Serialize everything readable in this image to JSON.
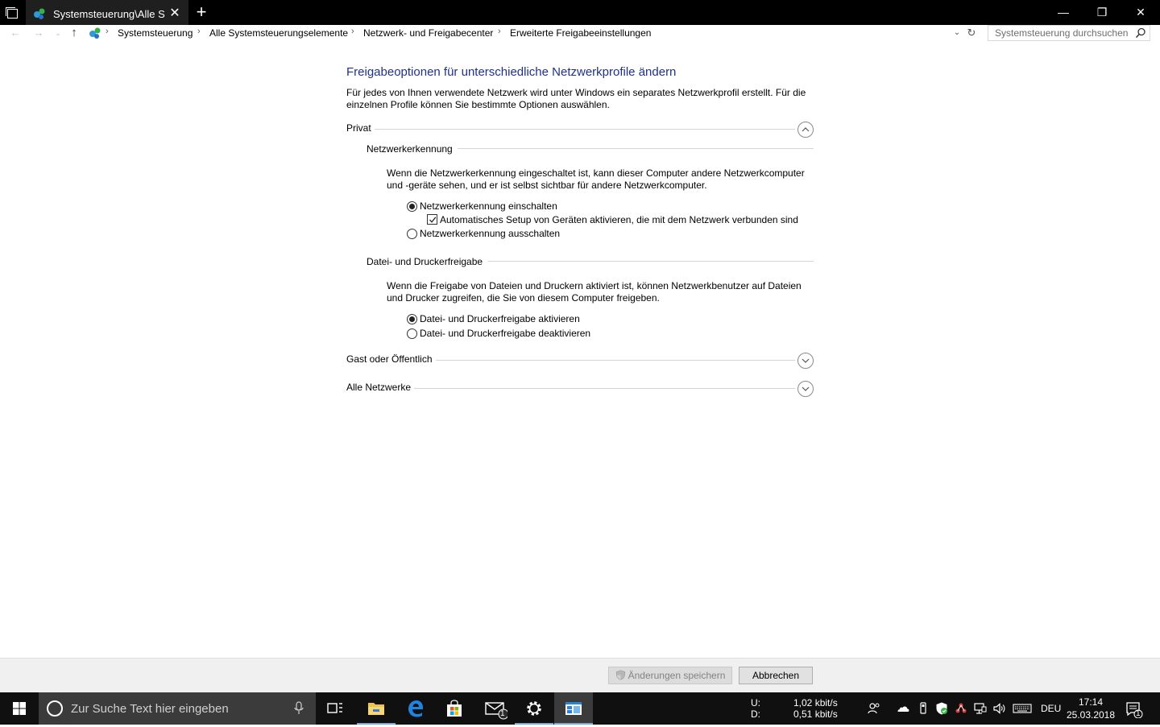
{
  "window": {
    "tab_title": "Systemsteuerung\\Alle S",
    "tab_close": "✕",
    "tab_add": "+",
    "minimize": "—",
    "maximize": "❐",
    "close": "✕"
  },
  "address": {
    "crumbs": [
      "Systemsteuerung",
      "Alle Systemsteuerungselemente",
      "Netzwerk- und Freigabecenter",
      "Erweiterte Freigabeeinstellungen"
    ],
    "separator": "›",
    "search_placeholder": "Systemsteuerung durchsuchen"
  },
  "content": {
    "title": "Freigabeoptionen für unterschiedliche Netzwerkprofile ändern",
    "intro": "Für jedes von Ihnen verwendete Netzwerk wird unter Windows ein separates Netzwerkprofil erstellt. Für die einzelnen Profile können Sie bestimmte Optionen auswählen.",
    "profiles": {
      "private": {
        "label": "Privat",
        "expanded": true,
        "discovery": {
          "heading": "Netzwerkerkennung",
          "description": "Wenn die Netzwerkerkennung eingeschaltet ist, kann dieser Computer andere Netzwerkcomputer und -geräte sehen, und er ist selbst sichtbar für andere Netzwerkcomputer.",
          "option_on": "Netzwerkerkennung einschalten",
          "option_auto_setup": "Automatisches Setup von Geräten aktivieren, die mit dem Netzwerk verbunden sind",
          "option_off": "Netzwerkerkennung ausschalten",
          "selected": "on",
          "auto_setup_checked": true
        },
        "sharing": {
          "heading": "Datei- und Druckerfreigabe",
          "description": "Wenn die Freigabe von Dateien und Druckern aktiviert ist, können Netzwerkbenutzer auf Dateien und Drucker zugreifen, die Sie von diesem Computer freigeben.",
          "option_on": "Datei- und Druckerfreigabe aktivieren",
          "option_off": "Datei- und Druckerfreigabe deaktivieren",
          "selected": "on"
        }
      },
      "guest": {
        "label": "Gast oder Öffentlich",
        "expanded": false
      },
      "all": {
        "label": "Alle Netzwerke",
        "expanded": false
      }
    }
  },
  "commands": {
    "save": "Änderungen speichern",
    "cancel": "Abbrechen"
  },
  "taskbar": {
    "search_placeholder": "Zur Suche Text hier eingeben",
    "net_up_label": "U:",
    "net_down_label": "D:",
    "net_up_value": "1,02 kbit/s",
    "net_down_value": "0,51 kbit/s",
    "language": "DEU",
    "time": "17:14",
    "date": "25.03.2018",
    "mail_badge": "1",
    "notification_badge": "1"
  },
  "colors": {
    "title_blue": "#1e3287",
    "accent": "#7ea7d8"
  }
}
